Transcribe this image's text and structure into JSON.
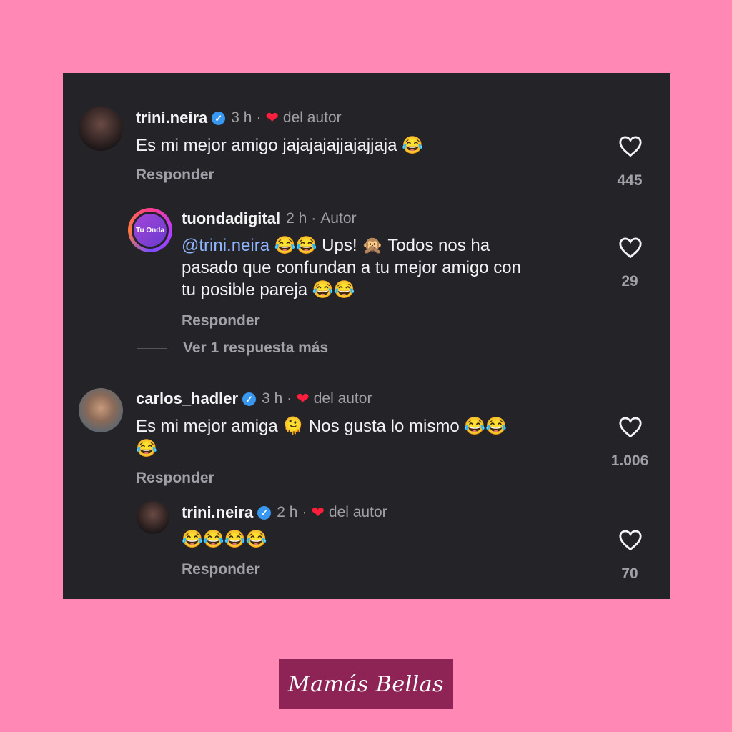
{
  "icons": {
    "verified": "verified-badge-icon",
    "heart_filled": "red-heart-icon",
    "like": "heart-outline-icon"
  },
  "colors": {
    "background": "#ff88b5",
    "panel": "#242428",
    "verified": "#3897f0",
    "author_heart": "#ff1e3c",
    "mention": "#8fb4ff",
    "brand": "#8e2456"
  },
  "comments": [
    {
      "username": "trini.neira",
      "time": "3 h",
      "author_label": "del autor",
      "text": "Es mi mejor amigo jajajajajjajajjaja 😂",
      "reply_label": "Responder",
      "likes": "445"
    },
    {
      "username": "tuondadigital",
      "avatar_text": "Tu Onda",
      "time": "2 h",
      "author_label": "Autor",
      "mention": "@trini.neira",
      "text_line1": " 😂😂 Ups! 🙊 Todos nos ha",
      "text_line2": "pasado que confundan a tu mejor amigo con",
      "text_line3": "tu posible pareja 😂😂",
      "reply_label": "Responder",
      "likes": "29",
      "more_replies": "Ver 1 respuesta más"
    },
    {
      "username": "carlos_hadler",
      "time": "3 h",
      "author_label": "del autor",
      "text_line1": "Es mi mejor amiga 🫠 Nos gusta lo mismo 😂😂",
      "text_line2": "😂",
      "reply_label": "Responder",
      "likes": "1.006"
    },
    {
      "username": "trini.neira",
      "time": "2 h",
      "author_label": "del autor",
      "text": "😂😂😂😂",
      "reply_label": "Responder",
      "likes": "70"
    }
  ],
  "brand": "Mamás Bellas"
}
